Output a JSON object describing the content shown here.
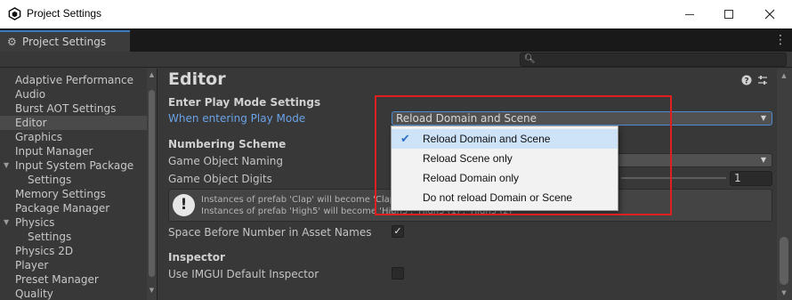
{
  "window": {
    "title": "Project Settings",
    "icon": "unity-logo-icon",
    "controls": {
      "minimize": "minimize-icon",
      "maximize": "maximize-icon",
      "close": "close-icon"
    }
  },
  "tab": {
    "label": "Project Settings",
    "icon": "gear-icon",
    "menu_icon": "kebab-menu-icon"
  },
  "search": {
    "value": "",
    "placeholder": "",
    "icon": "search-icon"
  },
  "sidebar": {
    "items": [
      {
        "label": "Adaptive Performance"
      },
      {
        "label": "Audio"
      },
      {
        "label": "Burst AOT Settings"
      },
      {
        "label": "Editor",
        "selected": true
      },
      {
        "label": "Graphics"
      },
      {
        "label": "Input Manager"
      },
      {
        "label": "Input System Package",
        "expandable": true
      },
      {
        "label": "Settings",
        "child": true
      },
      {
        "label": "Memory Settings"
      },
      {
        "label": "Package Manager"
      },
      {
        "label": "Physics",
        "expandable": true
      },
      {
        "label": "Settings",
        "child": true
      },
      {
        "label": "Physics 2D"
      },
      {
        "label": "Player"
      },
      {
        "label": "Preset Manager"
      },
      {
        "label": "Quality"
      }
    ]
  },
  "main": {
    "title": "Editor",
    "header_icons": [
      "help-icon",
      "preset-sliders-icon",
      "kebab-menu-icon"
    ],
    "play_mode": {
      "section": "Enter Play Mode Settings",
      "label": "When entering Play Mode",
      "value": "Reload Domain and Scene"
    },
    "numbering": {
      "section": "Numbering Scheme",
      "naming_label": "Game Object Naming",
      "digits_label": "Game Object Digits",
      "digits_value": "1",
      "help_line1": "Instances of prefab 'Clap' will become 'Clap', 'Clap (1)', 'Clap (2)'",
      "help_line2": "Instances of prefab 'High5' will become 'High5', 'High5 (1)', 'High5 (2)'",
      "space_label": "Space Before Number in Asset Names",
      "space_checked": true
    },
    "inspector": {
      "section": "Inspector",
      "imgui_label": "Use IMGUI Default Inspector",
      "imgui_checked": false
    }
  },
  "popup": {
    "options": [
      {
        "label": "Reload Domain and Scene",
        "selected": true
      },
      {
        "label": "Reload Scene only"
      },
      {
        "label": "Reload Domain only"
      },
      {
        "label": "Do not reload Domain or Scene"
      }
    ],
    "check_glyph": "✔"
  },
  "colors": {
    "accent_link": "#6aa3e8",
    "selection": "#cfe3f8",
    "annotation": "#e0201f",
    "panel_bg": "#383838"
  }
}
